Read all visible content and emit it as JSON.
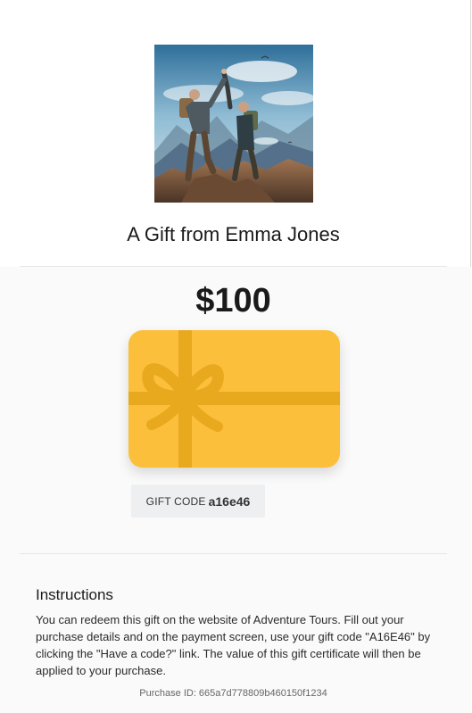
{
  "header": {
    "image_alt": "Two hikers on a mountain summit",
    "title": "A Gift from Emma Jones"
  },
  "gift": {
    "amount": "$100",
    "code_label": "GIFT CODE",
    "code_value": "a16e46",
    "card_color": "#fcbf3b",
    "ribbon_color": "#e8a91f"
  },
  "instructions": {
    "title": "Instructions",
    "body": "You can redeem this gift on the website of Adventure Tours. Fill out your purchase details and on the payment screen, use your gift code \"A16E46\" by clicking the \"Have a code?\" link. The value of this gift certificate will then be applied to your purchase."
  },
  "footer": {
    "purchase_id": "Purchase ID: 665a7d778809b460150f1234"
  }
}
